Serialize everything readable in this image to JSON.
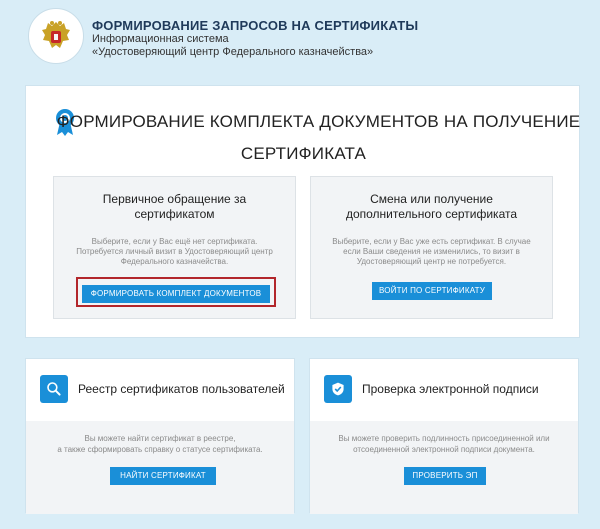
{
  "header": {
    "title": "ФОРМИРОВАНИЕ ЗАПРОСОВ НА СЕРТИФИКАТЫ",
    "subtitle_line1": "Информационная система",
    "subtitle_line2": "«Удостоверяющий центр Федерального казначейства»",
    "emblem_icon": "coat-of-arms-icon"
  },
  "main": {
    "title_line1": "ФОРМИРОВАНИЕ КОМПЛЕКТА ДОКУМЕНТОВ НА ПОЛУЧЕНИЕ",
    "title_line2": "СЕРТИФИКАТА",
    "icon": "ribbon-award-icon",
    "options": {
      "first": {
        "title_line1": "Первичное обращение за",
        "title_line2": "сертификатом",
        "desc_line1": "Выберите, если у Вас ещё нет сертификата.",
        "desc_line2": "Потребуется личный визит в Удостоверяющий центр",
        "desc_line3": "Федерального казначейства.",
        "button": "ФОРМИРОВАТЬ КОМПЛЕКТ ДОКУМЕНТОВ"
      },
      "second": {
        "title_line1": "Смена или получение",
        "title_line2": "дополнительного сертификата",
        "desc_line1": "Выберите, если у Вас уже есть сертификат. В случае",
        "desc_line2": "если Ваши сведения не изменились, то визит в",
        "desc_line3": "Удостоверяющий центр не потребуется.",
        "button": "ВОЙТИ ПО СЕРТИФИКАТУ"
      }
    }
  },
  "cards": {
    "registry": {
      "icon": "search-icon",
      "title": "Реестр сертификатов пользователей",
      "desc_line1": "Вы можете найти сертификат в реестре,",
      "desc_line2": "а также сформировать справку о статусе сертификата.",
      "button": "НАЙТИ СЕРТИФИКАТ"
    },
    "verify": {
      "icon": "shield-check-icon",
      "title": "Проверка электронной подписи",
      "desc_line1": "Вы можете проверить подлинность присоединенной или",
      "desc_line2": "отсоединенной электронной подписи документа.",
      "button": "ПРОВЕРИТЬ ЭП"
    }
  },
  "colors": {
    "background": "#d9edf7",
    "accent": "#1a8fd8",
    "highlight_border": "#b2262b"
  }
}
